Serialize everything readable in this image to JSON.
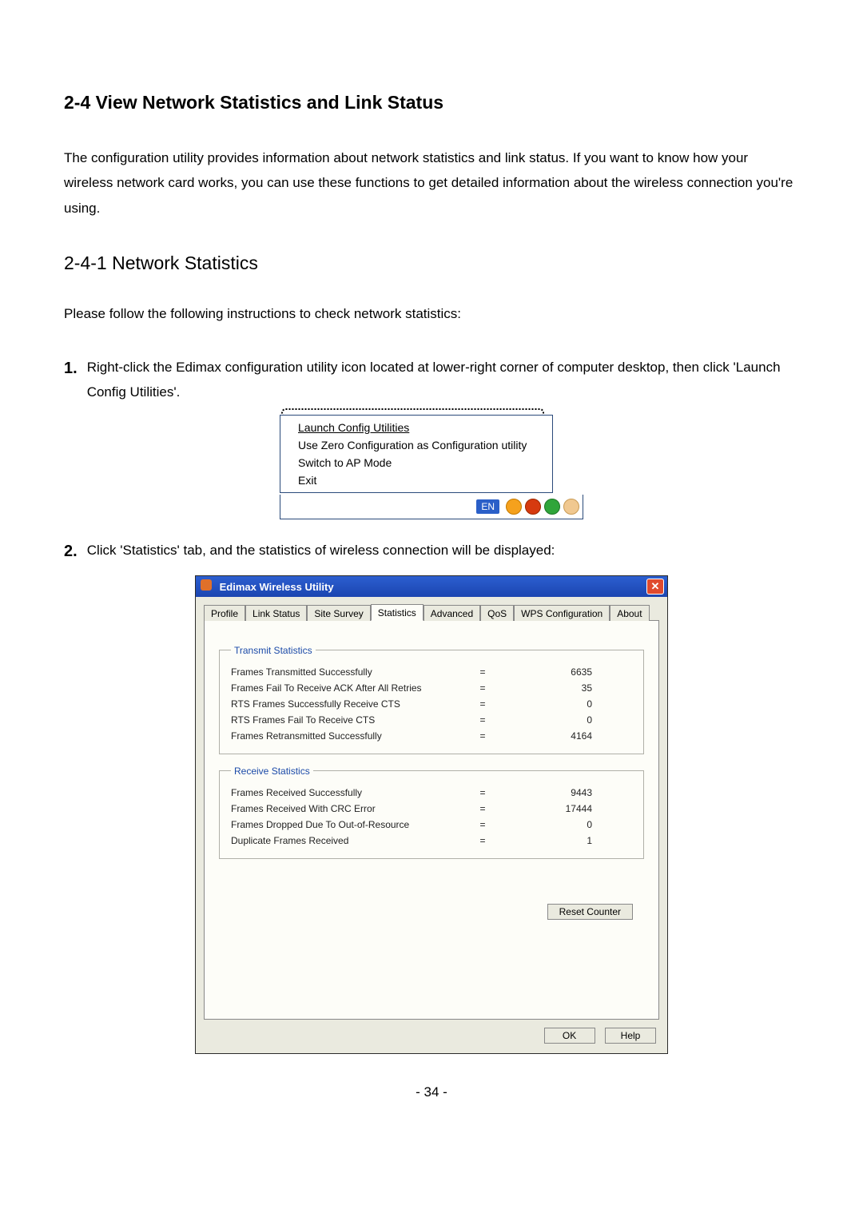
{
  "doc": {
    "h2": "2-4 View Network Statistics and Link Status",
    "intro": "The configuration utility provides information about network statistics and link status. If you want to know how your wireless network card works, you can use these functions to get detailed information about the wireless connection you're using.",
    "h3": "2-4-1 Network Statistics",
    "lead": "Please follow the following instructions to check network statistics:",
    "step1_num": "1.",
    "step1": "Right-click the Edimax configuration utility icon located at lower-right corner of computer desktop, then click 'Launch Config Utilities'.",
    "step2_num": "2.",
    "step2": "Click 'Statistics' tab, and the statistics of wireless connection will be displayed:",
    "page_num": "- 34 -"
  },
  "ctxmenu": {
    "items": {
      "0": "Launch Config Utilities",
      "1": "Use Zero Configuration as Configuration utility",
      "2": "Switch to AP Mode",
      "3": "Exit"
    },
    "lang": "EN"
  },
  "app": {
    "title": "Edimax Wireless Utility",
    "close_glyph": "✕",
    "tabs": {
      "0": "Profile",
      "1": "Link Status",
      "2": "Site Survey",
      "3": "Statistics",
      "4": "Advanced",
      "5": "QoS",
      "6": "WPS Configuration",
      "7": "About"
    },
    "tx_legend": "Transmit Statistics",
    "rx_legend": "Receive Statistics",
    "tx": {
      "0": {
        "label": "Frames Transmitted Successfully",
        "val": "6635"
      },
      "1": {
        "label": "Frames Fail To Receive ACK After All Retries",
        "val": "35"
      },
      "2": {
        "label": "RTS Frames Successfully Receive CTS",
        "val": "0"
      },
      "3": {
        "label": "RTS Frames Fail To Receive CTS",
        "val": "0"
      },
      "4": {
        "label": "Frames Retransmitted Successfully",
        "val": "4164"
      }
    },
    "rx": {
      "0": {
        "label": "Frames Received Successfully",
        "val": "9443"
      },
      "1": {
        "label": "Frames Received With CRC Error",
        "val": "17444"
      },
      "2": {
        "label": "Frames Dropped Due To Out-of-Resource",
        "val": "0"
      },
      "3": {
        "label": "Duplicate Frames Received",
        "val": "1"
      }
    },
    "eq": "=",
    "reset_label": "Reset Counter",
    "ok_label": "OK",
    "help_label": "Help"
  }
}
